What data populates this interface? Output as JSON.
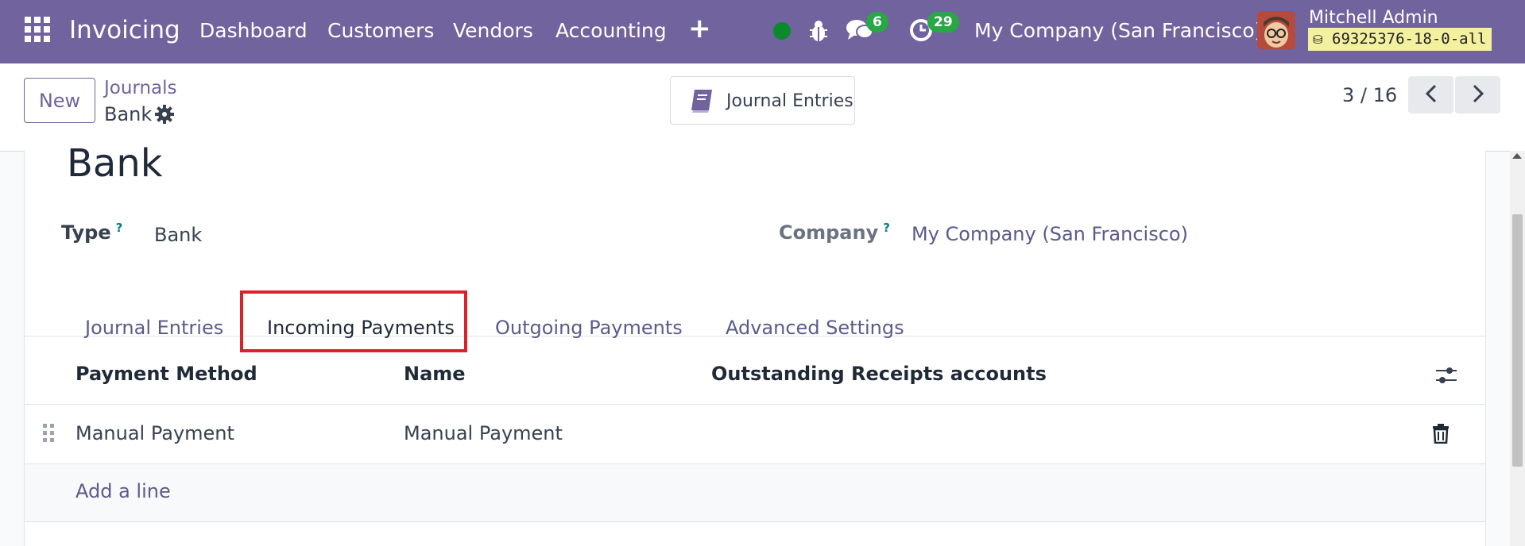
{
  "navbar": {
    "app_name": "Invoicing",
    "menu": [
      "Dashboard",
      "Customers",
      "Vendors",
      "Accounting"
    ],
    "messages_count": "6",
    "activities_count": "29",
    "company": "My Company (San Francisco)",
    "user_name": "Mitchell Admin",
    "database": "69325376-18-0-all",
    "brand_color": "#71639e"
  },
  "control_panel": {
    "new_label": "New",
    "breadcrumb_parent": "Journals",
    "breadcrumb_current": "Bank",
    "smart_button_label": "Journal Entries",
    "pager": "3 / 16"
  },
  "form": {
    "title": "Bank",
    "type_label": "Type",
    "type_help": "?",
    "type_value": "Bank",
    "company_label": "Company",
    "company_help": "?",
    "company_value": "My Company (San Francisco)",
    "tabs": [
      "Journal Entries",
      "Incoming Payments",
      "Outgoing Payments",
      "Advanced Settings"
    ],
    "active_tab": "Incoming Payments",
    "highlight_color": "#d8232a",
    "table": {
      "columns": [
        "Payment Method",
        "Name",
        "Outstanding Receipts accounts"
      ],
      "rows": [
        {
          "payment_method": "Manual Payment",
          "name": "Manual Payment",
          "outstanding": ""
        }
      ],
      "add_line": "Add a line"
    }
  }
}
